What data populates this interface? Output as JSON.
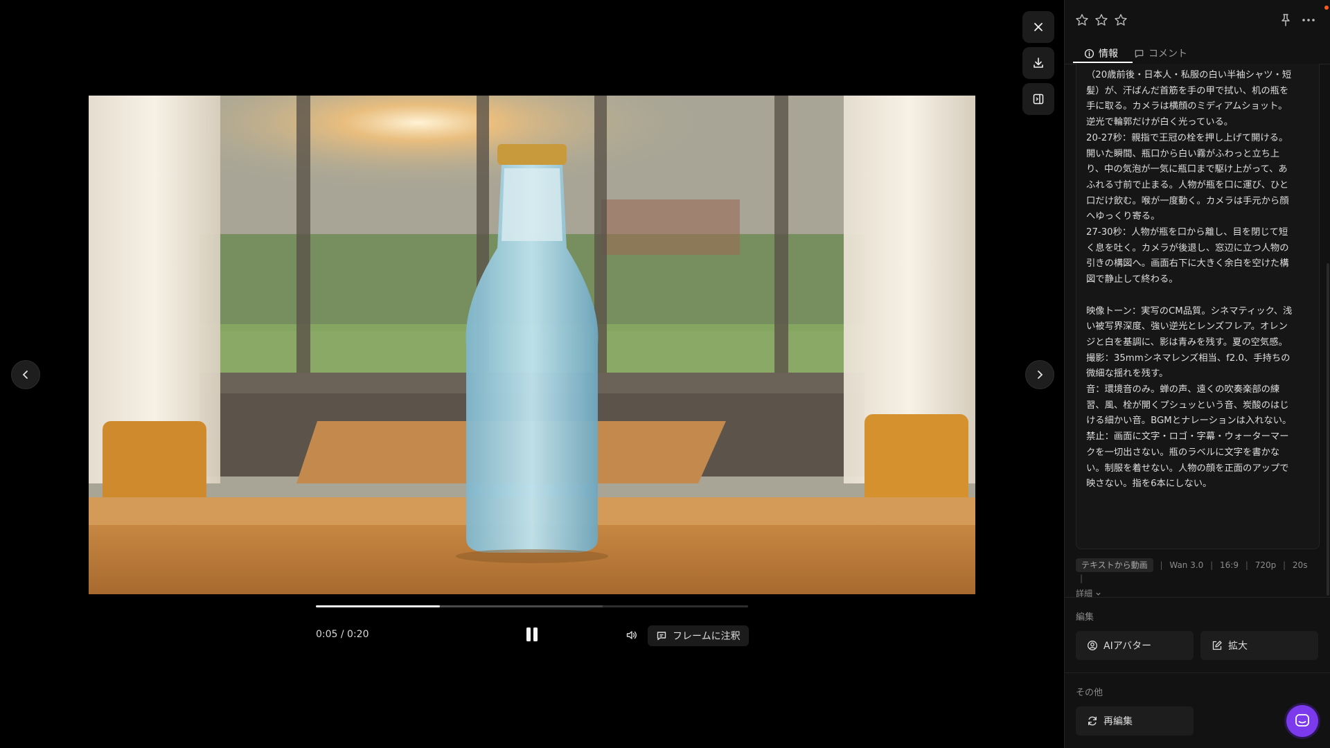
{
  "player": {
    "time": "0:05 / 0:20",
    "progress": 0.287,
    "buffered": 0.663,
    "annotate_label": "フレームに注釈"
  },
  "panel": {
    "rating_stars": 3,
    "tabs": {
      "info": "情報",
      "comment": "コメント"
    },
    "prompt_text": "（20歳前後・日本人・私服の白い半袖シャツ・短髪）が、汗ばんだ首筋を手の甲で拭い、机の瓶を手に取る。カメラは横顔のミディアムショット。逆光で輪郭だけが白く光っている。\n20-27秒：親指で王冠の栓を押し上げて開ける。開いた瞬間、瓶口から白い霧がふわっと立ち上り、中の気泡が一気に瓶口まで駆け上がって、あふれる寸前で止まる。人物が瓶を口に運び、ひと口だけ飲む。喉が一度動く。カメラは手元から顔へゆっくり寄る。\n27-30秒：人物が瓶を口から離し、目を閉じて短く息を吐く。カメラが後退し、窓辺に立つ人物の引きの構図へ。画面右下に大きく余白を空けた構図で静止して終わる。\n\n映像トーン：実写のCM品質。シネマティック、浅い被写界深度、強い逆光とレンズフレア。オレンジと白を基調に、影は青みを残す。夏の空気感。\n撮影：35mmシネマレンズ相当、f2.0、手持ちの微細な揺れを残す。\n音：環境音のみ。蝉の声、遠くの吹奏楽部の練習、風、栓が開くプシュッという音、炭酸のはじける細かい音。BGMとナレーションは入れない。\n禁止：画面に文字・ロゴ・字幕・ウォーターマークを一切出さない。瓶のラベルに文字を書かない。制服を着せない。人物の顔を正面のアップで映さない。指を6本にしない。",
    "meta": {
      "badge": "テキストから動画",
      "items": [
        "Wan 3.0",
        "16:9",
        "720p",
        "20s"
      ],
      "detail": "詳細"
    },
    "sections": {
      "edit": {
        "label": "編集",
        "ai_avatar": "AIアバター",
        "expand": "拡大"
      },
      "other": {
        "label": "その他",
        "reedit": "再編集"
      }
    }
  },
  "colors": {
    "panel_bg": "#121212",
    "accent_purple": "#7c3aed",
    "notification": "#ff5a1f"
  }
}
